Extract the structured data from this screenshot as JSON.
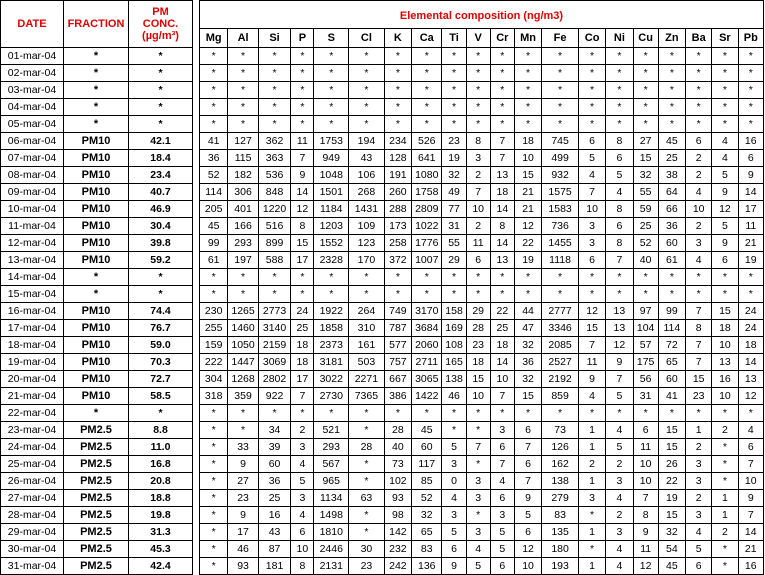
{
  "headers": {
    "date": "DATE",
    "fraction": "FRACTION",
    "pm_conc_line1": "PM",
    "pm_conc_line2": "CONC.",
    "pm_conc_line3": "(µg/m³)",
    "composition": "Elemental composition (ng/m3)"
  },
  "elements": [
    "Mg",
    "Al",
    "Si",
    "P",
    "S",
    "Cl",
    "K",
    "Ca",
    "Ti",
    "V",
    "Cr",
    "Mn",
    "Fe",
    "Co",
    "Ni",
    "Cu",
    "Zn",
    "Ba",
    "Sr",
    "Pb"
  ],
  "rows": [
    {
      "date": "01-mar-04",
      "fraction": "*",
      "conc": "*",
      "values": [
        "*",
        "*",
        "*",
        "*",
        "*",
        "*",
        "*",
        "*",
        "*",
        "*",
        "*",
        "*",
        "*",
        "*",
        "*",
        "*",
        "*",
        "*",
        "*",
        "*"
      ]
    },
    {
      "date": "02-mar-04",
      "fraction": "*",
      "conc": "*",
      "values": [
        "*",
        "*",
        "*",
        "*",
        "*",
        "*",
        "*",
        "*",
        "*",
        "*",
        "*",
        "*",
        "*",
        "*",
        "*",
        "*",
        "*",
        "*",
        "*",
        "*"
      ]
    },
    {
      "date": "03-mar-04",
      "fraction": "*",
      "conc": "*",
      "values": [
        "*",
        "*",
        "*",
        "*",
        "*",
        "*",
        "*",
        "*",
        "*",
        "*",
        "*",
        "*",
        "*",
        "*",
        "*",
        "*",
        "*",
        "*",
        "*",
        "*"
      ]
    },
    {
      "date": "04-mar-04",
      "fraction": "*",
      "conc": "*",
      "values": [
        "*",
        "*",
        "*",
        "*",
        "*",
        "*",
        "*",
        "*",
        "*",
        "*",
        "*",
        "*",
        "*",
        "*",
        "*",
        "*",
        "*",
        "*",
        "*",
        "*"
      ]
    },
    {
      "date": "05-mar-04",
      "fraction": "*",
      "conc": "*",
      "values": [
        "*",
        "*",
        "*",
        "*",
        "*",
        "*",
        "*",
        "*",
        "*",
        "*",
        "*",
        "*",
        "*",
        "*",
        "*",
        "*",
        "*",
        "*",
        "*",
        "*"
      ]
    },
    {
      "date": "06-mar-04",
      "fraction": "PM10",
      "conc": "42.1",
      "values": [
        "41",
        "127",
        "362",
        "11",
        "1753",
        "194",
        "234",
        "526",
        "23",
        "8",
        "7",
        "18",
        "745",
        "6",
        "8",
        "27",
        "45",
        "6",
        "4",
        "16"
      ]
    },
    {
      "date": "07-mar-04",
      "fraction": "PM10",
      "conc": "18.4",
      "values": [
        "36",
        "115",
        "363",
        "7",
        "949",
        "43",
        "128",
        "641",
        "19",
        "3",
        "7",
        "10",
        "499",
        "5",
        "6",
        "15",
        "25",
        "2",
        "4",
        "6"
      ]
    },
    {
      "date": "08-mar-04",
      "fraction": "PM10",
      "conc": "23.4",
      "values": [
        "52",
        "182",
        "536",
        "9",
        "1048",
        "106",
        "191",
        "1080",
        "32",
        "2",
        "13",
        "15",
        "932",
        "4",
        "5",
        "32",
        "38",
        "2",
        "5",
        "9"
      ]
    },
    {
      "date": "09-mar-04",
      "fraction": "PM10",
      "conc": "40.7",
      "values": [
        "114",
        "306",
        "848",
        "14",
        "1501",
        "268",
        "260",
        "1758",
        "49",
        "7",
        "18",
        "21",
        "1575",
        "7",
        "4",
        "55",
        "64",
        "4",
        "9",
        "14"
      ]
    },
    {
      "date": "10-mar-04",
      "fraction": "PM10",
      "conc": "46.9",
      "values": [
        "205",
        "401",
        "1220",
        "12",
        "1184",
        "1431",
        "288",
        "2809",
        "77",
        "10",
        "14",
        "21",
        "1583",
        "10",
        "8",
        "59",
        "66",
        "10",
        "12",
        "17"
      ]
    },
    {
      "date": "11-mar-04",
      "fraction": "PM10",
      "conc": "30.4",
      "values": [
        "45",
        "166",
        "516",
        "8",
        "1203",
        "109",
        "173",
        "1022",
        "31",
        "2",
        "8",
        "12",
        "736",
        "3",
        "6",
        "25",
        "36",
        "2",
        "5",
        "11"
      ]
    },
    {
      "date": "12-mar-04",
      "fraction": "PM10",
      "conc": "39.8",
      "values": [
        "99",
        "293",
        "899",
        "15",
        "1552",
        "123",
        "258",
        "1776",
        "55",
        "11",
        "14",
        "22",
        "1455",
        "3",
        "8",
        "52",
        "60",
        "3",
        "9",
        "21"
      ]
    },
    {
      "date": "13-mar-04",
      "fraction": "PM10",
      "conc": "59.2",
      "values": [
        "61",
        "197",
        "588",
        "17",
        "2328",
        "170",
        "372",
        "1007",
        "29",
        "6",
        "13",
        "19",
        "1118",
        "6",
        "7",
        "40",
        "61",
        "4",
        "6",
        "19"
      ]
    },
    {
      "date": "14-mar-04",
      "fraction": "*",
      "conc": "*",
      "values": [
        "*",
        "*",
        "*",
        "*",
        "*",
        "*",
        "*",
        "*",
        "*",
        "*",
        "*",
        "*",
        "*",
        "*",
        "*",
        "*",
        "*",
        "*",
        "*",
        "*"
      ]
    },
    {
      "date": "15-mar-04",
      "fraction": "*",
      "conc": "*",
      "values": [
        "*",
        "*",
        "*",
        "*",
        "*",
        "*",
        "*",
        "*",
        "*",
        "*",
        "*",
        "*",
        "*",
        "*",
        "*",
        "*",
        "*",
        "*",
        "*",
        "*"
      ]
    },
    {
      "date": "16-mar-04",
      "fraction": "PM10",
      "conc": "74.4",
      "values": [
        "230",
        "1265",
        "2773",
        "24",
        "1922",
        "264",
        "749",
        "3170",
        "158",
        "29",
        "22",
        "44",
        "2777",
        "12",
        "13",
        "97",
        "99",
        "7",
        "15",
        "24"
      ]
    },
    {
      "date": "17-mar-04",
      "fraction": "PM10",
      "conc": "76.7",
      "values": [
        "255",
        "1460",
        "3140",
        "25",
        "1858",
        "310",
        "787",
        "3684",
        "169",
        "28",
        "25",
        "47",
        "3346",
        "15",
        "13",
        "104",
        "114",
        "8",
        "18",
        "24"
      ]
    },
    {
      "date": "18-mar-04",
      "fraction": "PM10",
      "conc": "59.0",
      "values": [
        "159",
        "1050",
        "2159",
        "18",
        "2373",
        "161",
        "577",
        "2060",
        "108",
        "23",
        "18",
        "32",
        "2085",
        "7",
        "12",
        "57",
        "72",
        "7",
        "10",
        "18"
      ]
    },
    {
      "date": "19-mar-04",
      "fraction": "PM10",
      "conc": "70.3",
      "values": [
        "222",
        "1447",
        "3069",
        "18",
        "3181",
        "503",
        "757",
        "2711",
        "165",
        "18",
        "14",
        "36",
        "2527",
        "11",
        "9",
        "175",
        "65",
        "7",
        "13",
        "14"
      ]
    },
    {
      "date": "20-mar-04",
      "fraction": "PM10",
      "conc": "72.7",
      "values": [
        "304",
        "1268",
        "2802",
        "17",
        "3022",
        "2271",
        "667",
        "3065",
        "138",
        "15",
        "10",
        "32",
        "2192",
        "9",
        "7",
        "56",
        "60",
        "15",
        "16",
        "13"
      ]
    },
    {
      "date": "21-mar-04",
      "fraction": "PM10",
      "conc": "58.5",
      "values": [
        "318",
        "359",
        "922",
        "7",
        "2730",
        "7365",
        "386",
        "1422",
        "46",
        "10",
        "7",
        "15",
        "859",
        "4",
        "5",
        "31",
        "41",
        "23",
        "10",
        "12"
      ]
    },
    {
      "date": "22-mar-04",
      "fraction": "*",
      "conc": "*",
      "values": [
        "*",
        "*",
        "*",
        "*",
        "*",
        "*",
        "*",
        "*",
        "*",
        "*",
        "*",
        "*",
        "*",
        "*",
        "*",
        "*",
        "*",
        "*",
        "*",
        "*"
      ]
    },
    {
      "date": "23-mar-04",
      "fraction": "PM2.5",
      "conc": "8.8",
      "values": [
        "*",
        "*",
        "34",
        "2",
        "521",
        "*",
        "28",
        "45",
        "*",
        "*",
        "3",
        "6",
        "73",
        "1",
        "4",
        "6",
        "15",
        "1",
        "2",
        "4"
      ]
    },
    {
      "date": "24-mar-04",
      "fraction": "PM2.5",
      "conc": "11.0",
      "values": [
        "*",
        "33",
        "39",
        "3",
        "293",
        "28",
        "40",
        "60",
        "5",
        "7",
        "6",
        "7",
        "126",
        "1",
        "5",
        "11",
        "15",
        "2",
        "*",
        "6"
      ]
    },
    {
      "date": "25-mar-04",
      "fraction": "PM2.5",
      "conc": "16.8",
      "values": [
        "*",
        "9",
        "60",
        "4",
        "567",
        "*",
        "73",
        "117",
        "3",
        "*",
        "7",
        "6",
        "162",
        "2",
        "2",
        "10",
        "26",
        "3",
        "*",
        "7"
      ]
    },
    {
      "date": "26-mar-04",
      "fraction": "PM2.5",
      "conc": "20.8",
      "values": [
        "*",
        "27",
        "36",
        "5",
        "965",
        "*",
        "102",
        "85",
        "0",
        "3",
        "4",
        "7",
        "138",
        "1",
        "3",
        "10",
        "22",
        "3",
        "*",
        "10"
      ]
    },
    {
      "date": "27-mar-04",
      "fraction": "PM2.5",
      "conc": "18.8",
      "values": [
        "*",
        "23",
        "25",
        "3",
        "1134",
        "63",
        "93",
        "52",
        "4",
        "3",
        "6",
        "9",
        "279",
        "3",
        "4",
        "7",
        "19",
        "2",
        "1",
        "9"
      ]
    },
    {
      "date": "28-mar-04",
      "fraction": "PM2.5",
      "conc": "19.8",
      "values": [
        "*",
        "9",
        "16",
        "4",
        "1498",
        "*",
        "98",
        "32",
        "3",
        "*",
        "3",
        "5",
        "83",
        "*",
        "2",
        "8",
        "15",
        "3",
        "1",
        "7"
      ]
    },
    {
      "date": "29-mar-04",
      "fraction": "PM2.5",
      "conc": "31.3",
      "values": [
        "*",
        "17",
        "43",
        "6",
        "1810",
        "*",
        "142",
        "65",
        "5",
        "3",
        "5",
        "6",
        "135",
        "1",
        "3",
        "9",
        "32",
        "4",
        "2",
        "14"
      ]
    },
    {
      "date": "30-mar-04",
      "fraction": "PM2.5",
      "conc": "45.3",
      "values": [
        "*",
        "46",
        "87",
        "10",
        "2446",
        "30",
        "232",
        "83",
        "6",
        "4",
        "5",
        "12",
        "180",
        "*",
        "4",
        "11",
        "54",
        "5",
        "*",
        "21"
      ]
    },
    {
      "date": "31-mar-04",
      "fraction": "PM2.5",
      "conc": "42.4",
      "values": [
        "*",
        "93",
        "181",
        "8",
        "2131",
        "23",
        "242",
        "136",
        "9",
        "5",
        "6",
        "10",
        "193",
        "1",
        "4",
        "12",
        "45",
        "6",
        "*",
        "16"
      ]
    }
  ]
}
